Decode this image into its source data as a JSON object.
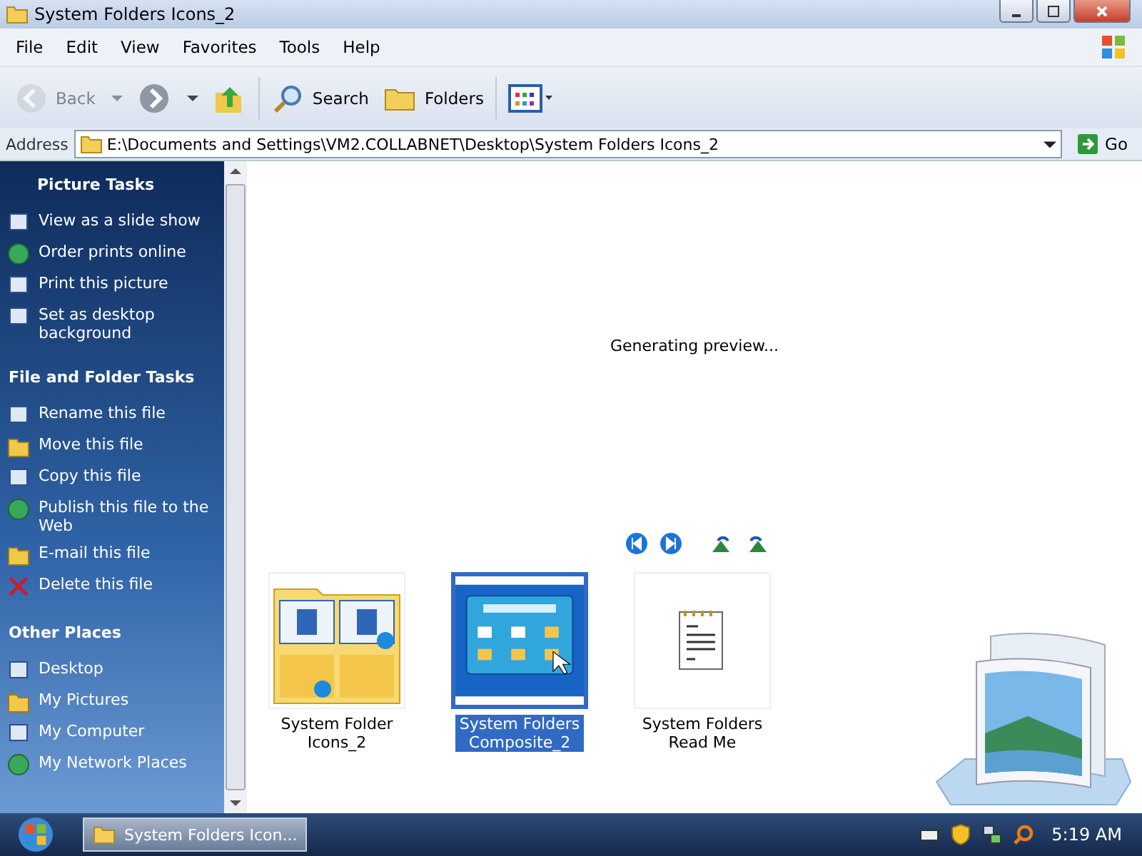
{
  "window": {
    "title": "System Folders Icons_2"
  },
  "menu": [
    "File",
    "Edit",
    "View",
    "Favorites",
    "Tools",
    "Help"
  ],
  "toolbar": [
    {
      "kind": "back",
      "label": "Back",
      "disabled": true
    },
    {
      "kind": "forward",
      "disabled": false
    },
    {
      "kind": "up",
      "disabled": false
    },
    {
      "kind": "search",
      "label": "Search",
      "disabled": false
    },
    {
      "kind": "folders",
      "label": "Folders",
      "disabled": false
    },
    {
      "kind": "views",
      "disabled": false
    }
  ],
  "address": {
    "label": "Address",
    "value": "E:\\Documents and Settings\\VM2.COLLABNET\\Desktop\\System Folders Icons_2",
    "go": "Go"
  },
  "sidebar": [
    {
      "title": "Picture Tasks",
      "items": [
        {
          "label": "View as a slide show"
        },
        {
          "label": "Order prints online"
        },
        {
          "label": "Print this picture"
        },
        {
          "label": "Set as desktop background"
        }
      ]
    },
    {
      "title": "File and Folder Tasks",
      "items": [
        {
          "label": "Rename this file"
        },
        {
          "label": "Move this file"
        },
        {
          "label": "Copy this file"
        },
        {
          "label": "Publish this file to the Web"
        },
        {
          "label": "E-mail this file"
        },
        {
          "label": "Delete this file"
        }
      ]
    },
    {
      "title": "Other Places",
      "items": [
        {
          "label": "Desktop"
        },
        {
          "label": "My Pictures"
        },
        {
          "label": "My Computer"
        },
        {
          "label": "My Network Places"
        }
      ]
    }
  ],
  "preview": {
    "message": "Generating preview..."
  },
  "files": [
    {
      "kind": "folder",
      "name": "System Folder Icons_2",
      "selected": false
    },
    {
      "kind": "image",
      "name": "System Folders Composite_2",
      "selected": true
    },
    {
      "kind": "text",
      "name": "System Folders Read Me",
      "selected": false
    }
  ],
  "taskbar": {
    "task": "System Folders Icon...",
    "clock": "5:19 AM"
  }
}
